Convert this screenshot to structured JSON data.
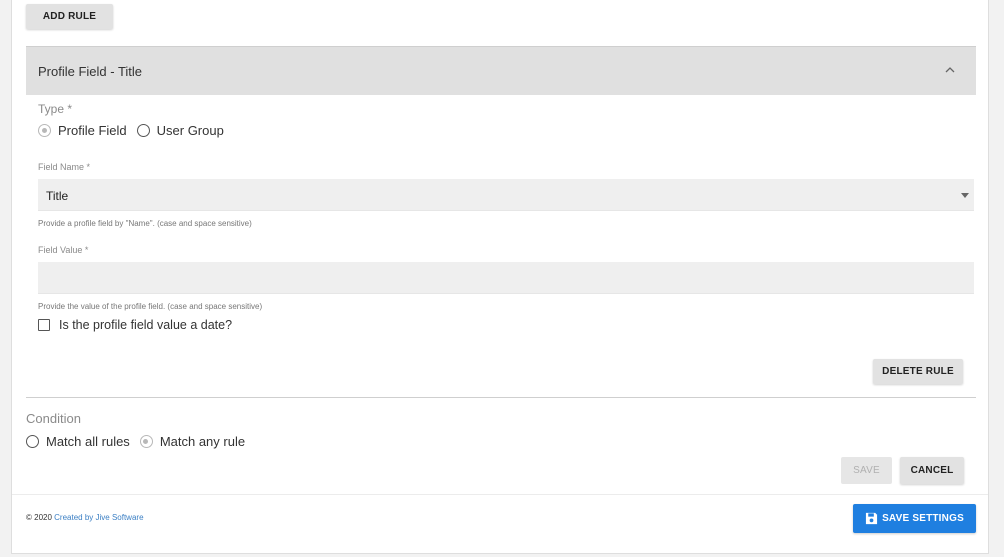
{
  "toolbar": {
    "add_rule_label": "ADD RULE"
  },
  "rule": {
    "header_title": "Profile Field - Title",
    "type_label": "Type *",
    "type_options": [
      "Profile Field",
      "User Group"
    ],
    "type_selected": "Profile Field",
    "field_name_label": "Field Name *",
    "field_name_value": "Title",
    "field_name_help": "Provide a profile field by \"Name\". (case and space sensitive)",
    "field_value_label": "Field Value *",
    "field_value_value": "",
    "field_value_help": "Provide the value of the profile field. (case and space sensitive)",
    "date_checkbox_label": "Is the profile field value a date?",
    "date_checked": false,
    "delete_label": "DELETE RULE"
  },
  "condition": {
    "label": "Condition",
    "options": [
      "Match all rules",
      "Match any rule"
    ],
    "selected": "Match any rule"
  },
  "actions": {
    "save_label": "SAVE",
    "cancel_label": "CANCEL",
    "save_settings_label": "SAVE SETTINGS"
  },
  "footer": {
    "copyright": "© 2020",
    "link_text": "Created by Jive Software"
  },
  "colors": {
    "primary": "#1f7fe0",
    "header_bg": "#e0e0e0",
    "field_bg": "#efefef",
    "link": "#3b7fc4"
  },
  "icons": {
    "collapse": "chevron-up-icon",
    "dropdown": "caret-down-icon",
    "save": "floppy-disk-icon"
  }
}
